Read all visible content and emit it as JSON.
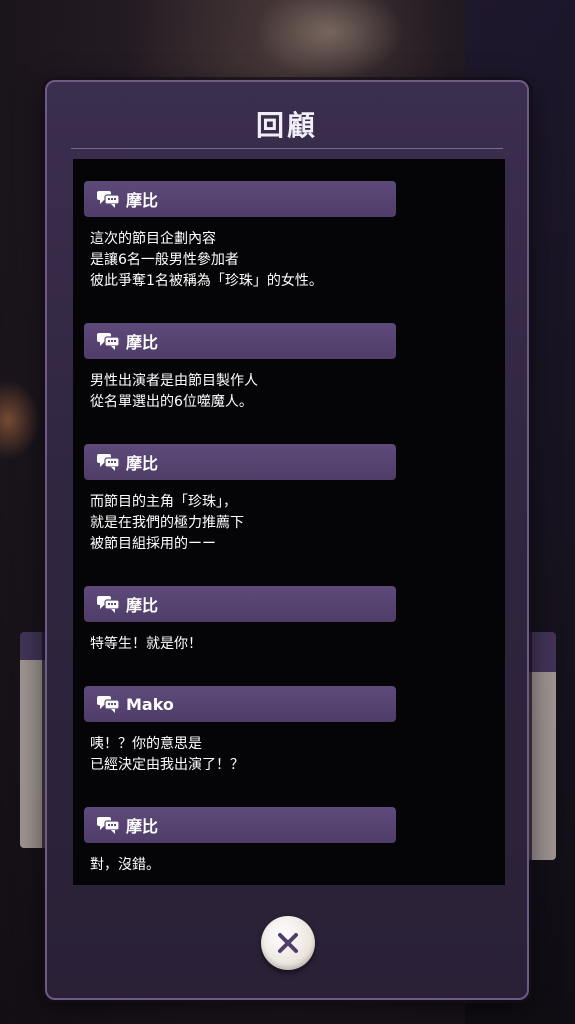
{
  "dialog": {
    "title": "回顧"
  },
  "log_entries": [
    {
      "speaker": "摩比",
      "text": "這次的節目企劃內容\n是讓6名一般男性參加者\n彼此爭奪1名被稱為「珍珠」的女性。"
    },
    {
      "speaker": "摩比",
      "text": "男性出演者是由節目製作人\n從名單選出的6位噬魔人。"
    },
    {
      "speaker": "摩比",
      "text": "而節目的主角「珍珠」，\n就是在我們的極力推薦下\n被節目組採用的ーー"
    },
    {
      "speaker": "摩比",
      "text": "特等生！就是你！"
    },
    {
      "speaker": "Mako",
      "text": "咦！？你的意思是\n已經決定由我出演了！？"
    },
    {
      "speaker": "摩比",
      "text": "對，沒錯。"
    }
  ],
  "icons": {
    "speaker": "speech-bubble-icon",
    "close": "close-icon"
  },
  "colors": {
    "panel": "#3b2e4e",
    "speaker_bar": "#5e4a7a",
    "log_background": "#050507"
  }
}
